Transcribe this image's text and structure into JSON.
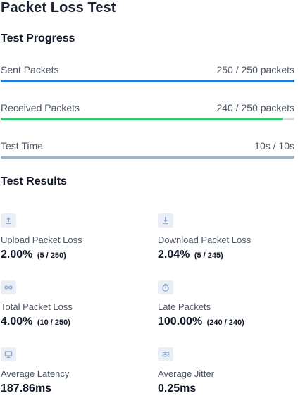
{
  "page": {
    "title": "Packet Loss Test"
  },
  "progress": {
    "title": "Test Progress",
    "rows": [
      {
        "label": "Sent Packets",
        "value": "250 / 250 packets",
        "fraction": 1.0,
        "color": "#1f7ae0"
      },
      {
        "label": "Received Packets",
        "value": "240 / 250 packets",
        "fraction": 0.96,
        "color": "#2ecc71"
      },
      {
        "label": "Test Time",
        "value": "10s / 10s",
        "fraction": 1.0,
        "color": "#9fb3c8"
      }
    ]
  },
  "results": {
    "title": "Test Results",
    "metrics": [
      {
        "icon": "upload-icon",
        "label": "Upload Packet Loss",
        "value": "2.00%",
        "detail": "(5 / 250)"
      },
      {
        "icon": "download-icon",
        "label": "Download Packet Loss",
        "value": "2.04%",
        "detail": "(5 / 245)"
      },
      {
        "icon": "infinity-icon",
        "label": "Total Packet Loss",
        "value": "4.00%",
        "detail": "(10 / 250)"
      },
      {
        "icon": "stopwatch-icon",
        "label": "Late Packets",
        "value": "100.00%",
        "detail": "(240 / 240)"
      },
      {
        "icon": "monitor-icon",
        "label": "Average Latency",
        "value": "187.86ms",
        "detail": ""
      },
      {
        "icon": "waves-icon",
        "label": "Average Jitter",
        "value": "0.25ms",
        "detail": ""
      }
    ]
  }
}
